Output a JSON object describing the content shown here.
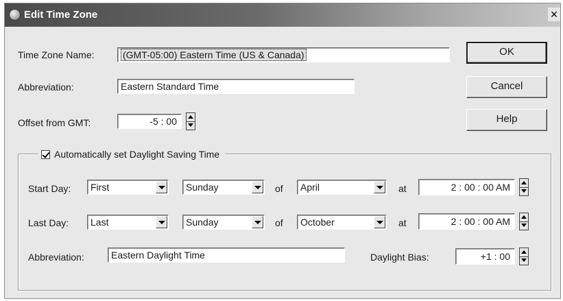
{
  "window": {
    "title": "Edit Time Zone",
    "close_label": "×"
  },
  "time_zone": {
    "name_label": "Time Zone Name:",
    "name_value": "(GMT-05:00) Eastern Time (US & Canada)",
    "abbrev_label": "Abbreviation:",
    "abbrev_value": "Eastern Standard Time",
    "offset_label": "Offset from GMT:",
    "offset_value": "-5 : 00"
  },
  "buttons": {
    "ok": "OK",
    "cancel": "Cancel",
    "help": "Help"
  },
  "dst": {
    "checkbox_label": "Automatically set Daylight Saving Time",
    "checked": true,
    "start_label": "Start Day:",
    "start_week": "First",
    "start_weekday": "Sunday",
    "of_label": "of",
    "start_month": "April",
    "at_label": "at",
    "start_time": "2 : 00 : 00 AM",
    "last_label": "Last Day:",
    "last_week": "Last",
    "last_weekday": "Sunday",
    "last_month": "October",
    "last_time": "2 : 00 : 00 AM",
    "abbrev_label": "Abbreviation:",
    "abbrev_value": "Eastern Daylight Time",
    "bias_label": "Daylight Bias:",
    "bias_value": "+1 : 00"
  },
  "icons": {
    "title": "globe-icon",
    "close": "close-icon",
    "dropdown": "chevron-down-icon",
    "spinner": "spinner-arrows-icon",
    "check": "checkmark-icon"
  }
}
